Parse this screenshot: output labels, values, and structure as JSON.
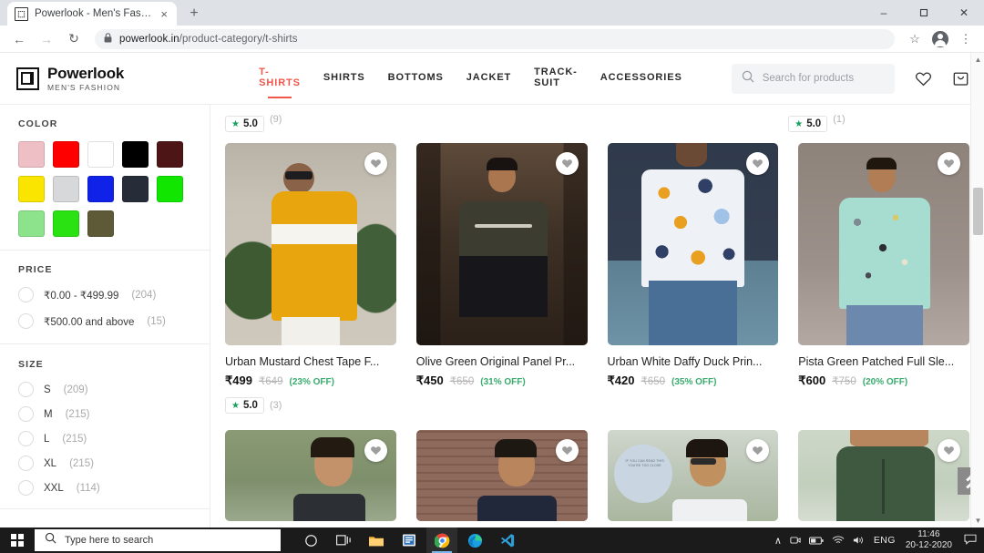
{
  "browser": {
    "tab": {
      "title": "Powerlook - Men's Fashion",
      "favicon": "powerlook-logo-icon",
      "close": "×"
    },
    "newtab_label": "+",
    "window_controls": {
      "minimize": "–",
      "maximize": "❐",
      "close": "✕"
    },
    "nav": {
      "back": "←",
      "forward": "→",
      "reload": "↻"
    },
    "omnibox": {
      "lock": "🔒",
      "url_host": "powerlook.in",
      "url_path": "/product-category/t-shirts"
    },
    "toolbar_icons": {
      "bookmark": "☆",
      "profile": "profile-avatar-icon",
      "menu": "⋮"
    }
  },
  "site": {
    "brand": {
      "name": "Powerlook",
      "tagline": "MEN'S FASHION"
    },
    "nav": [
      {
        "label": "T-SHIRTS",
        "active": true
      },
      {
        "label": "SHIRTS",
        "active": false
      },
      {
        "label": "BOTTOMS",
        "active": false
      },
      {
        "label": "JACKET",
        "active": false
      },
      {
        "label": "TRACK-SUIT",
        "active": false
      },
      {
        "label": "ACCESSORIES",
        "active": false
      }
    ],
    "search": {
      "placeholder": "Search for products",
      "icon": "search-icon"
    },
    "header_icons": {
      "wishlist": "heart-icon",
      "cart": "shopping-bag-icon"
    }
  },
  "filters": {
    "color": {
      "title": "COLOR",
      "swatches": [
        {
          "name": "pink",
          "hex": "#efbfc6"
        },
        {
          "name": "red",
          "hex": "#fe0000"
        },
        {
          "name": "white",
          "hex": "#ffffff"
        },
        {
          "name": "black",
          "hex": "#000000"
        },
        {
          "name": "maroon",
          "hex": "#4d1515"
        },
        {
          "name": "yellow",
          "hex": "#f9e500"
        },
        {
          "name": "light-grey",
          "hex": "#d6d8da"
        },
        {
          "name": "blue",
          "hex": "#1122e8"
        },
        {
          "name": "navy",
          "hex": "#262d39"
        },
        {
          "name": "green",
          "hex": "#11e600"
        },
        {
          "name": "pista-green",
          "hex": "#8ce38b"
        },
        {
          "name": "bright-green",
          "hex": "#2ae212"
        },
        {
          "name": "olive",
          "hex": "#5e5937"
        }
      ]
    },
    "price": {
      "title": "PRICE",
      "options": [
        {
          "label": "₹0.00 - ₹499.99",
          "count": "(204)"
        },
        {
          "label": "₹500.00 and above",
          "count": "(15)"
        }
      ]
    },
    "size": {
      "title": "SIZE",
      "options": [
        {
          "label": "S",
          "count": "(209)"
        },
        {
          "label": "M",
          "count": "(215)"
        },
        {
          "label": "L",
          "count": "(215)"
        },
        {
          "label": "XL",
          "count": "(215)"
        },
        {
          "label": "XXL",
          "count": "(114)"
        }
      ]
    }
  },
  "top_ratings": [
    {
      "star": "★",
      "value": "5.0",
      "count": "(9)"
    },
    {
      "star": "★",
      "value": "5.0",
      "count": "(1)"
    }
  ],
  "products": [
    {
      "title": "Urban Mustard Chest Tape F...",
      "price": "₹499",
      "was": "₹649",
      "off": "(23% OFF)",
      "rating": {
        "star": "★",
        "value": "5.0",
        "count": "(3)"
      },
      "wishlist_icon": "heart-icon"
    },
    {
      "title": "Olive Green Original Panel Pr...",
      "price": "₹450",
      "was": "₹650",
      "off": "(31% OFF)",
      "rating": null,
      "wishlist_icon": "heart-icon"
    },
    {
      "title": "Urban White Daffy Duck Prin...",
      "price": "₹420",
      "was": "₹650",
      "off": "(35% OFF)",
      "rating": null,
      "wishlist_icon": "heart-icon"
    },
    {
      "title": "Pista Green Patched Full Sle...",
      "price": "₹600",
      "was": "₹750",
      "off": "(20% OFF)",
      "rating": null,
      "wishlist_icon": "heart-icon"
    }
  ],
  "next_row": [
    {
      "wishlist_icon": "heart-icon"
    },
    {
      "wishlist_icon": "heart-icon"
    },
    {
      "wishlist_icon": "heart-icon",
      "overlay_text": "IF YOU CAN READ THIS YOU'RE TOO CLOSE"
    },
    {
      "wishlist_icon": "heart-icon"
    }
  ],
  "scroll_top": {
    "icon": "double-chevron-up-icon"
  },
  "taskbar": {
    "start": "windows-logo-icon",
    "search_placeholder": "Type here to search",
    "search_icon": "search-icon",
    "apps": [
      {
        "name": "cortana-icon"
      },
      {
        "name": "task-view-icon"
      },
      {
        "name": "file-explorer-icon"
      },
      {
        "name": "microsoft-store-icon"
      },
      {
        "name": "google-chrome-icon",
        "active": true
      },
      {
        "name": "microsoft-edge-icon"
      },
      {
        "name": "vs-code-icon"
      }
    ],
    "tray": {
      "overflow": "∧",
      "camera": "camera-icon",
      "battery": "battery-icon",
      "wifi": "wifi-icon",
      "volume": "volume-icon",
      "language": "ENG",
      "time": "11:46",
      "date": "20-12-2020",
      "notifications": "notification-icon"
    }
  },
  "colors": {
    "accent": "#f0564a",
    "discount_green": "#3aaa6e",
    "rating_green": "#17a05e",
    "taskbar": "#1b1b1b"
  }
}
